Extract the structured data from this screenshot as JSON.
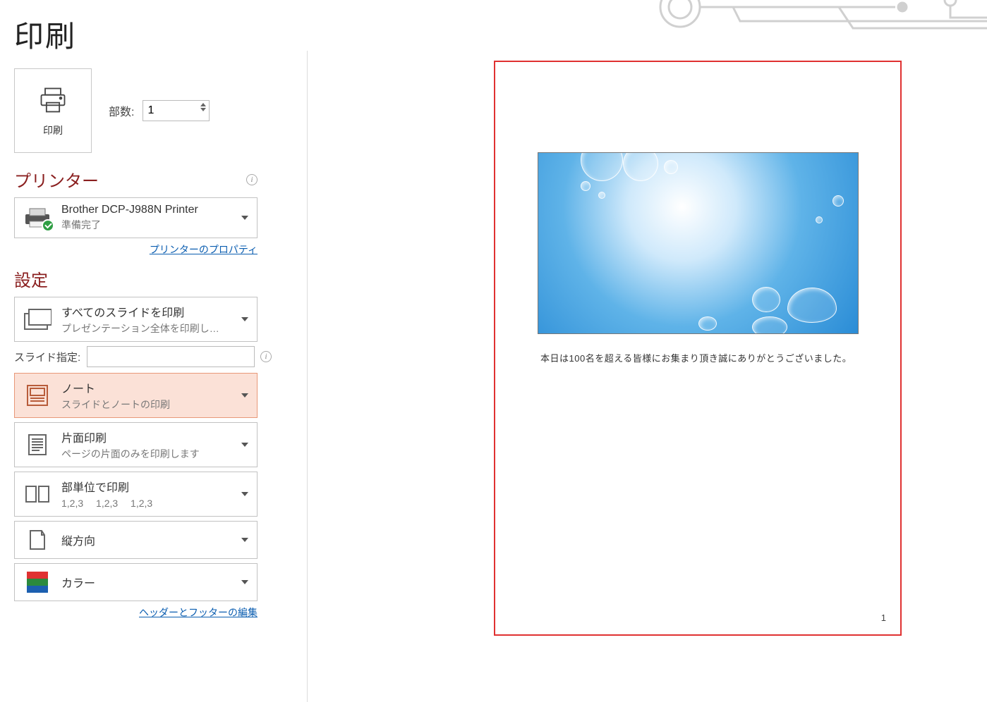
{
  "title": "印刷",
  "print_button_label": "印刷",
  "copies": {
    "label": "部数:",
    "value": "1"
  },
  "printer_section": {
    "heading": "プリンター",
    "name": "Brother DCP-J988N Printer",
    "status": "準備完了",
    "properties_link": "プリンターのプロパティ"
  },
  "settings_section": {
    "heading": "設定",
    "range": {
      "title": "すべてのスライドを印刷",
      "sub": "プレゼンテーション全体を印刷し…"
    },
    "slide_range": {
      "label": "スライド指定:",
      "value": ""
    },
    "layout": {
      "title": "ノート",
      "sub": "スライドとノートの印刷"
    },
    "sides": {
      "title": "片面印刷",
      "sub": "ページの片面のみを印刷します"
    },
    "collate": {
      "title": "部単位で印刷",
      "sub": "1,2,3　 1,2,3　 1,2,3"
    },
    "orientation": {
      "title": "縦方向"
    },
    "color": {
      "title": "カラー"
    },
    "header_footer_link": "ヘッダーとフッターの編集"
  },
  "preview": {
    "note_text": "本日は100名を超える皆様にお集まり頂き誠にありがとうございました。",
    "page_number": "1"
  }
}
